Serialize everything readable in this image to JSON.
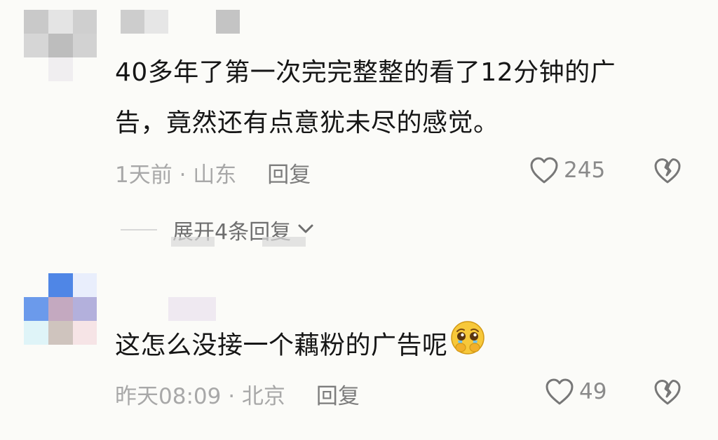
{
  "comments": [
    {
      "text_line1": "40多年了第一次完完整整的看了12分钟的广",
      "text_line2": "告，竟然还有点意犹未尽的感觉。",
      "time_location": "1天前 · 山东",
      "reply_label": "回复",
      "like_count": "245",
      "expand_label": "展开4条回复"
    },
    {
      "text": "这怎么没接一个藕粉的广告呢",
      "emoji": "pleading-face-emoji",
      "time_location": "昨天08:09 · 北京",
      "reply_label": "回复",
      "like_count": "49"
    }
  ],
  "icons": {
    "like": "heart-icon",
    "dislike": "broken-heart-icon",
    "expand": "chevron-down-icon"
  },
  "colors": {
    "background": "#fbfbf8",
    "text": "#161616",
    "meta": "#a8a8a8",
    "reply": "#7d7d7d"
  }
}
